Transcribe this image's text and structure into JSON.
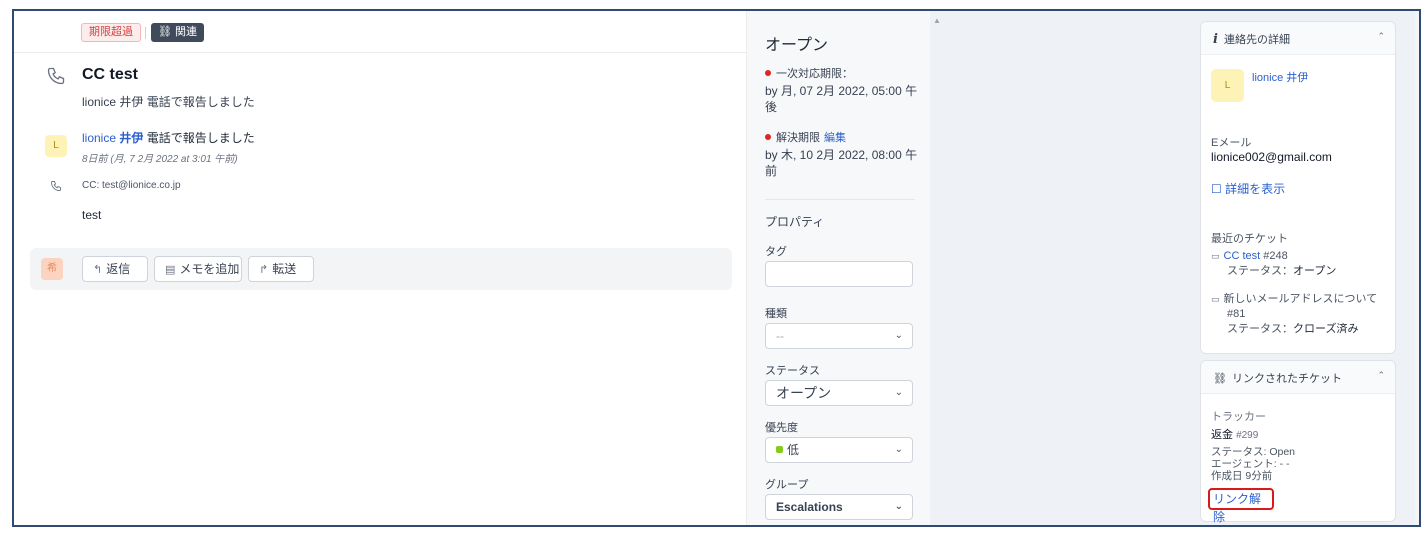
{
  "topbar": {
    "overdue_label": "期限超過",
    "related_label": "関連"
  },
  "ticket": {
    "title": "CC test",
    "subtitle": "lionice 井伊 電話で報告しました"
  },
  "message": {
    "avatar_letter": "L",
    "author_first": "lionice",
    "author_last": "井伊",
    "action": "電話で報告しました",
    "time": "8日前 (月, 7 2月 2022 at 3:01 午前)",
    "cc": "CC: test@lionice.co.jp",
    "body": "test"
  },
  "replybar": {
    "avatar_letter": "希",
    "reply_label": "返信",
    "note_label": "メモを追加",
    "forward_label": "転送"
  },
  "props": {
    "status_title": "オープン",
    "first_response_label": "一次対応期限：",
    "first_response_value": "by 月, 07 2月 2022, 05:00 午後",
    "resolution_label": "解決期限",
    "resolution_edit": "編集",
    "resolution_value": "by 木, 10 2月 2022, 08:00 午前",
    "properties_heading": "プロパティ",
    "tags_label": "タグ",
    "type_label": "種類",
    "type_value": "--",
    "status_label": "ステータス",
    "status_value": "オープン",
    "priority_label": "優先度",
    "priority_value": "低",
    "group_label": "グループ",
    "group_value": "Escalations"
  },
  "contact": {
    "heading": "連絡先の詳細",
    "avatar_letter": "L",
    "name": "lionice 井伊",
    "email_label": "Eメール",
    "email": "lionice002@gmail.com",
    "details_link": "詳細を表示",
    "recent_heading": "最近のチケット",
    "recent": [
      {
        "title": "CC test",
        "num": "#248",
        "status_label": "ステータス：",
        "status": "オープン"
      },
      {
        "title": "新しいメールアドレスについて",
        "num": "#81",
        "status_label": "ステータス：",
        "status": "クローズ済み"
      }
    ]
  },
  "linked": {
    "heading": "リンクされたチケット",
    "tracker_label": "トラッカー",
    "item_title": "返金",
    "item_num": "#299",
    "status": "ステータス: Open",
    "agent": "エージェント: - -",
    "created": "作成日 9分前",
    "unlink_label": "リンク解除"
  },
  "colors": {
    "accent": "#2b5fcf",
    "overdue": "#d14343",
    "highlight": "#d91a1a"
  }
}
